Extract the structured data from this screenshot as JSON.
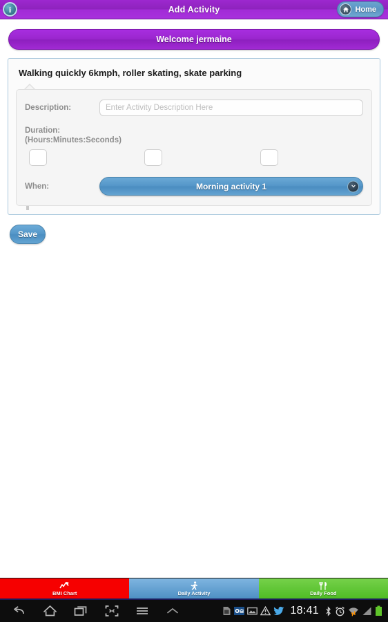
{
  "titlebar": {
    "title": "Add Activity",
    "info_icon": "info-icon",
    "info_glyph": "i",
    "home_label": "Home",
    "home_icon": "home-icon",
    "bg_color": "#9d28cf"
  },
  "welcome": {
    "text": "Welcome jermaine",
    "bg_color": "#a82ee0"
  },
  "card": {
    "title": "Walking quickly 6kmph, roller skating, skate parking",
    "border_color": "#a9c8dd"
  },
  "form": {
    "description_label": "Description:",
    "description_value": "",
    "description_placeholder": "Enter Activity Description Here",
    "duration_label_line1": "Duration:",
    "duration_label_line2": "(Hours:Minutes:Seconds)",
    "duration_hours": "",
    "duration_minutes": "",
    "duration_seconds": "",
    "when_label": "When:",
    "when_selected": "Morning activity 1",
    "when_chevron_icon": "chevron-down-icon",
    "when_color": "#5496c8"
  },
  "actions": {
    "save_label": "Save",
    "save_color": "#5497c9"
  },
  "tabs": [
    {
      "label": "BMI Chart",
      "icon": "chart-icon",
      "color": "#f60000"
    },
    {
      "label": "Daily Activity",
      "icon": "running-person-icon",
      "color": "#4e90c4"
    },
    {
      "label": "Daily Food",
      "icon": "fork-knife-icon",
      "color": "#4fbc26"
    }
  ],
  "navbar": {
    "buttons": [
      {
        "icon": "back-icon"
      },
      {
        "icon": "home-outline-icon"
      },
      {
        "icon": "recent-apps-icon"
      },
      {
        "icon": "screenshot-icon"
      },
      {
        "icon": "menu-icon"
      },
      {
        "icon": "chevron-up-icon"
      }
    ],
    "status_icons": [
      {
        "icon": "sd-card-icon"
      },
      {
        "icon": "outlook-mail-icon"
      },
      {
        "icon": "image-icon"
      },
      {
        "icon": "warning-icon"
      },
      {
        "icon": "twitter-bird-icon"
      }
    ],
    "clock": "18:41",
    "right_icons": [
      {
        "icon": "bluetooth-icon"
      },
      {
        "icon": "alarm-clock-icon"
      },
      {
        "icon": "wifi-icon"
      },
      {
        "icon": "signal-bars-icon"
      },
      {
        "icon": "battery-icon"
      }
    ]
  }
}
